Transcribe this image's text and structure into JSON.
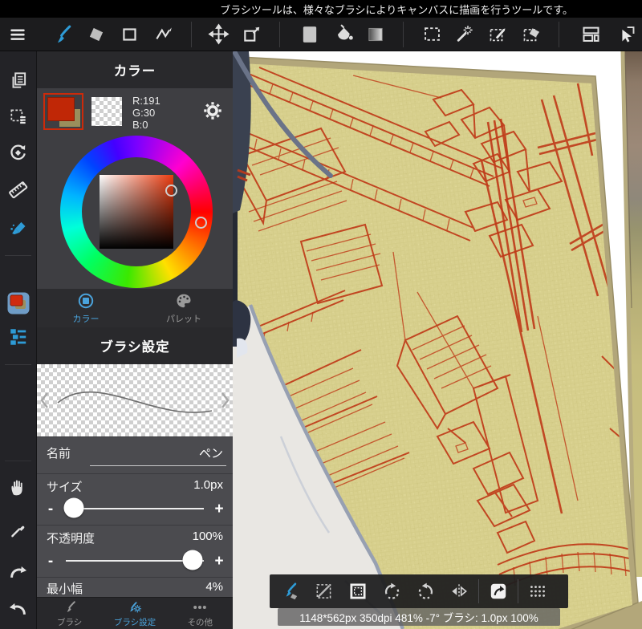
{
  "help_bar": {
    "text": "ブラシツールは、様々なブラシによりキャンバスに描画を行うツールです。"
  },
  "toolbar": {
    "icons": [
      "menu",
      "brush",
      "eraser",
      "shape",
      "polyline",
      "move",
      "transform",
      "color-swatch",
      "bucket-fill",
      "gradient",
      "select-rect",
      "magic-wand",
      "select-pen",
      "select-eraser",
      "window-layout",
      "pointer"
    ],
    "active_tool": "brush"
  },
  "sidebar": {
    "icons": [
      "pages",
      "select-layer",
      "reset-view",
      "ruler",
      "material",
      "color-chip",
      "layers",
      "hand",
      "eyedropper",
      "redo",
      "undo"
    ]
  },
  "color_panel": {
    "title": "カラー",
    "rgb": {
      "r": "R:191",
      "g": "G:30",
      "b": "B:0"
    },
    "foreground_hex": "#c02706",
    "tabs": [
      {
        "label": "カラー",
        "active": true
      },
      {
        "label": "パレット",
        "active": false
      }
    ]
  },
  "brush_panel": {
    "title": "ブラシ設定",
    "name_label": "名前",
    "name_value": "ペン",
    "size_label": "サイズ",
    "size_value": "1.0px",
    "size_knob_left": "6%",
    "opacity_label": "不透明度",
    "opacity_value": "100%",
    "opacity_knob_left": "92%",
    "minwidth_label": "最小幅",
    "minwidth_value": "4%",
    "minus": "-",
    "plus": "+"
  },
  "panel_tabs": [
    {
      "label": "ブラシ",
      "active": false
    },
    {
      "label": "ブラシ設定",
      "active": true
    },
    {
      "label": "その他",
      "active": false
    }
  ],
  "canvas_toolbar": {
    "icons": [
      "brush-eraser-toggle",
      "deselect",
      "select-all",
      "rotate-ccw",
      "rotate-cw",
      "flip-horizontal",
      "shortcut",
      "drag-handle"
    ]
  },
  "status_bar": {
    "text": "1148*562px 350dpi 481% -7° ブラシ: 1.0px 100%"
  },
  "colors": {
    "accent": "#4aa3dc",
    "paper": "#d8d08e",
    "sketch": "#bf3a18"
  }
}
